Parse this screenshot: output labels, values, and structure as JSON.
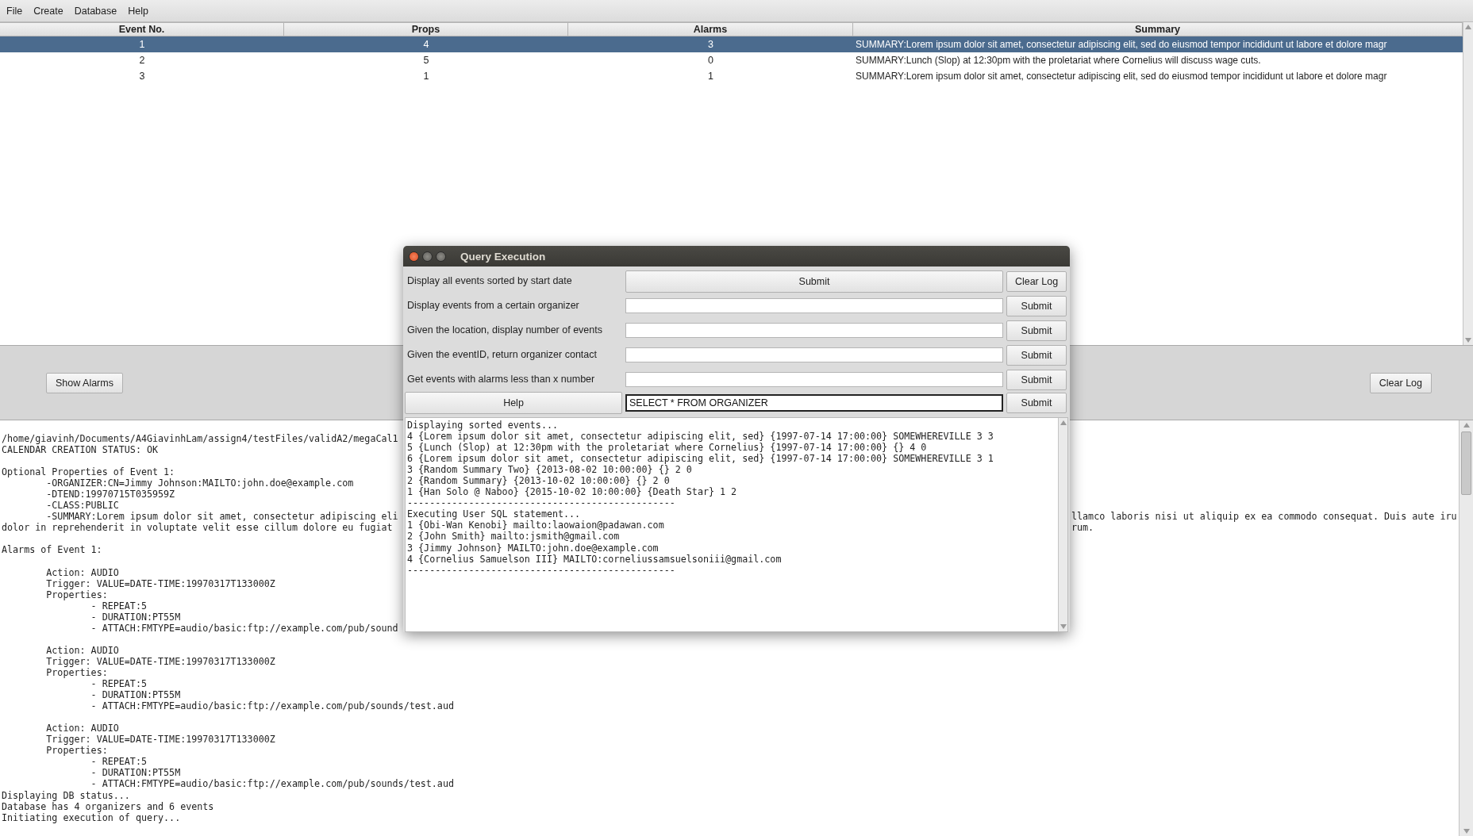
{
  "menu": [
    "File",
    "Create",
    "Database",
    "Help"
  ],
  "table": {
    "columns": [
      "Event No.",
      "Props",
      "Alarms",
      "Summary"
    ],
    "rows": [
      {
        "cells": [
          "1",
          "4",
          "3",
          "SUMMARY:Lorem ipsum dolor sit amet, consectetur adipiscing elit, sed do eiusmod tempor incididunt ut labore et dolore magr"
        ],
        "selected": true
      },
      {
        "cells": [
          "2",
          "5",
          "0",
          "SUMMARY:Lunch (Slop) at 12:30pm with the proletariat where Cornelius will discuss wage cuts."
        ],
        "selected": false
      },
      {
        "cells": [
          "3",
          "1",
          "1",
          "SUMMARY:Lorem ipsum dolor sit amet, consectetur adipiscing elit, sed do eiusmod tempor incididunt ut labore et dolore magr"
        ],
        "selected": false
      }
    ]
  },
  "panel_buttons": [
    "Show Alarms",
    "Clear Log"
  ],
  "log": {
    "blocks": [
      [
        {
          "text": "/home/giavinh/Documents/A4GiavinhLam/assign4/testFiles/validA2/megaCal1"
        },
        {
          "text": "CALENDAR CREATION STATUS: OK"
        }
      ],
      [
        {
          "text": "Optional Properties of Event 1:"
        },
        {
          "text": "\t-ORGANIZER:CN=Jimmy Johnson:MAILTO:john.doe@example.com"
        },
        {
          "text": "\t-DTEND:19970715T035959Z"
        },
        {
          "text": "\t-CLASS:PUBLIC"
        },
        {
          "text": "\t-SUMMARY:Lorem ipsum dolor sit amet, consectetur adipiscing eli",
          "tail": "llamco laboris nisi ut aliquip ex ea commodo consequat. Duis aute iru"
        },
        {
          "text": "dolor in reprehenderit in voluptate velit esse cillum dolore eu fugiat",
          "tail": "rum."
        }
      ],
      [
        {
          "text": "Alarms of Event 1:"
        }
      ],
      [
        {
          "text": "\tAction: AUDIO"
        },
        {
          "text": "\tTrigger: VALUE=DATE-TIME:19970317T133000Z"
        },
        {
          "text": "\tProperties:"
        },
        {
          "text": "\t\t- REPEAT:5"
        },
        {
          "text": "\t\t- DURATION:PT55M"
        },
        {
          "text": "\t\t- ATTACH:FMTYPE=audio/basic:ftp://example.com/pub/sound"
        }
      ],
      [
        {
          "text": "\tAction: AUDIO"
        },
        {
          "text": "\tTrigger: VALUE=DATE-TIME:19970317T133000Z"
        },
        {
          "text": "\tProperties:"
        },
        {
          "text": "\t\t- REPEAT:5"
        },
        {
          "text": "\t\t- DURATION:PT55M"
        },
        {
          "text": "\t\t- ATTACH:FMTYPE=audio/basic:ftp://example.com/pub/sounds/test.aud"
        }
      ],
      [
        {
          "text": "\tAction: AUDIO"
        },
        {
          "text": "\tTrigger: VALUE=DATE-TIME:19970317T133000Z"
        },
        {
          "text": "\tProperties:"
        },
        {
          "text": "\t\t- REPEAT:5"
        },
        {
          "text": "\t\t- DURATION:PT55M"
        },
        {
          "text": "\t\t- ATTACH:FMTYPE=audio/basic:ftp://example.com/pub/sounds/test.aud"
        },
        {
          "text": "Displaying DB status..."
        },
        {
          "text": "Database has 4 organizers and 6 events"
        },
        {
          "text": "Initiating execution of query..."
        }
      ]
    ]
  },
  "dialog": {
    "title": "Query Execution",
    "queries": [
      {
        "kind": "action",
        "label": "Display all events sorted by start date",
        "button": "Submit",
        "extra": "Clear Log"
      },
      {
        "kind": "field",
        "label": "Display events from a certain organizer",
        "button": "Submit"
      },
      {
        "kind": "field",
        "label": "Given the location, display number of events",
        "button": "Submit"
      },
      {
        "kind": "field",
        "label": "Given the eventID, return organizer contact",
        "button": "Submit"
      },
      {
        "kind": "field",
        "label": "Get events with alarms less than x number",
        "button": "Submit"
      },
      {
        "kind": "sql",
        "label": "Help",
        "value": "SELECT * FROM ORGANIZER",
        "focused": true,
        "button": "Submit"
      }
    ],
    "output": [
      "Displaying sorted events...",
      "4 {Lorem ipsum dolor sit amet, consectetur adipiscing elit, sed} {1997-07-14 17:00:00} SOMEWHEREVILLE 3 3",
      "5 {Lunch (Slop) at 12:30pm with the proletariat where Cornelius} {1997-07-14 17:00:00} {} 4 0",
      "6 {Lorem ipsum dolor sit amet, consectetur adipiscing elit, sed} {1997-07-14 17:00:00} SOMEWHEREVILLE 3 1",
      "3 {Random Summary Two} {2013-08-02 10:00:00} {} 2 0",
      "2 {Random Summary} {2013-10-02 10:00:00} {} 2 0",
      "1 {Han Solo @ Naboo} {2015-10-02 10:00:00} {Death Star} 1 2",
      "------------------------------------------------",
      "Executing User SQL statement...",
      "1 {Obi-Wan Kenobi} mailto:laowaion@padawan.com",
      "2 {John Smith} mailto:jsmith@gmail.com",
      "3 {Jimmy Johnson} MAILTO:john.doe@example.com",
      "4 {Cornelius Samuelson III} MAILTO:corneliussamsuelsoniii@gmail.com",
      "------------------------------------------------"
    ]
  }
}
